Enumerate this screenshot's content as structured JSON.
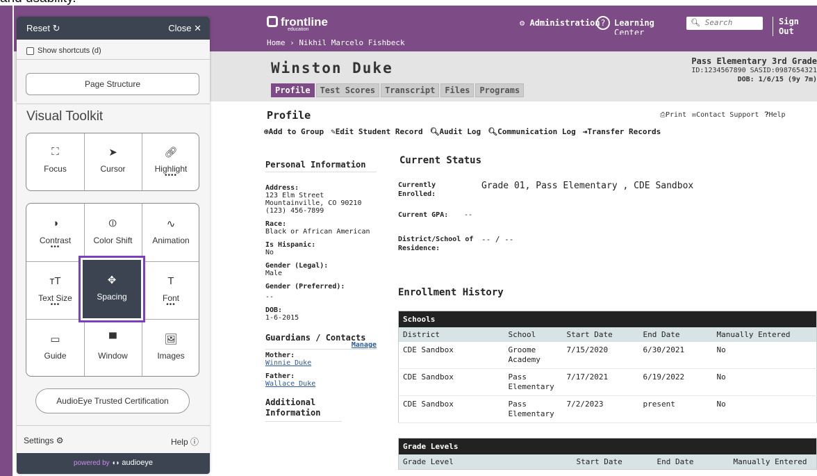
{
  "caption_fragment": "and usability.",
  "header": {
    "brand": "frontline",
    "brand_sub": "education",
    "breadcrumb": "Home › Nikhil Marcelo Fishbeck",
    "admin": "Administration",
    "learning": "Learning",
    "learning2": "Center",
    "search_placeholder": "Search",
    "signout": "Sign Out"
  },
  "student": {
    "name": "Winston Duke",
    "school_line": "Pass Elementary  3rd Grade",
    "id_line": "ID:1234567890  SASID:0987654321",
    "dob_line": "DOB: 1/6/15 (9y 7m)",
    "tabs": [
      "Profile",
      "Test Scores",
      "Transcript",
      "Files",
      "Programs"
    ]
  },
  "profile": {
    "title": "Profile",
    "actions": [
      "Add to Group",
      "Edit Student Record",
      "Audit Log",
      "Communication Log",
      "Transfer Records"
    ],
    "print": "Print",
    "contact": "Contact Support",
    "help": "Help"
  },
  "personal": {
    "title": "Personal Information",
    "address_label": "Address:",
    "address": [
      "123 Elm Street",
      "Mountainville, CO 90210",
      "(123) 456-7899"
    ],
    "race_label": "Race:",
    "race": "Black or African American",
    "hispanic_label": "Is Hispanic:",
    "hispanic": "No",
    "gender_label": "Gender (Legal):",
    "gender": "Male",
    "pgender_label": "Gender (Preferred):",
    "pgender": "--",
    "dob_label": "DOB:",
    "dob": "1-6-2015",
    "guardians_title": "Guardians / Contacts",
    "manage": "Manage",
    "mother_label": "Mother:",
    "mother": "Winnie Duke",
    "father_label": "Father:",
    "father": "Wallace Duke",
    "additional_title": "Additional Information"
  },
  "status": {
    "title": "Current Status",
    "enrolled_label": "Currently Enrolled:",
    "enrolled": "Grade 01, Pass Elementary , CDE Sandbox",
    "gpa_label": "Current GPA:",
    "gpa": "--",
    "district_label": "District/School of Residence:",
    "district": "-- / --"
  },
  "enrollment": {
    "title": "Enrollment History",
    "caption": "Schools",
    "columns": [
      "District",
      "School",
      "Start Date",
      "End Date",
      "Manually Entered"
    ],
    "rows": [
      [
        "CDE Sandbox",
        "Groome Academy",
        "7/15/2020",
        "6/30/2021",
        "No"
      ],
      [
        "CDE Sandbox",
        "Pass Elementary",
        "7/17/2021",
        "6/19/2022",
        "No"
      ],
      [
        "CDE Sandbox",
        "Pass Elementary",
        "7/2/2023",
        "present",
        "No"
      ]
    ]
  },
  "grades": {
    "caption": "Grade Levels",
    "columns": [
      "Grade Level",
      "Start Date",
      "End Date",
      "Manually Entered"
    ]
  },
  "toolkit": {
    "reset": "Reset",
    "close": "Close",
    "shortcuts": "Show shortcuts (d)",
    "page_structure": "Page Structure",
    "title": "Visual Toolkit",
    "group1": [
      "Focus",
      "Cursor",
      "Highlight"
    ],
    "group2": [
      "Contrast",
      "Color Shift",
      "Animation",
      "Text Size",
      "Spacing",
      "Font",
      "Guide",
      "Window",
      "Images"
    ],
    "certification": "AudioEye Trusted Certification",
    "settings": "Settings",
    "help": "Help",
    "powered_by": "powered by",
    "brand": "audioeye",
    "selected": "Spacing",
    "accent": "#7b3fbf"
  }
}
